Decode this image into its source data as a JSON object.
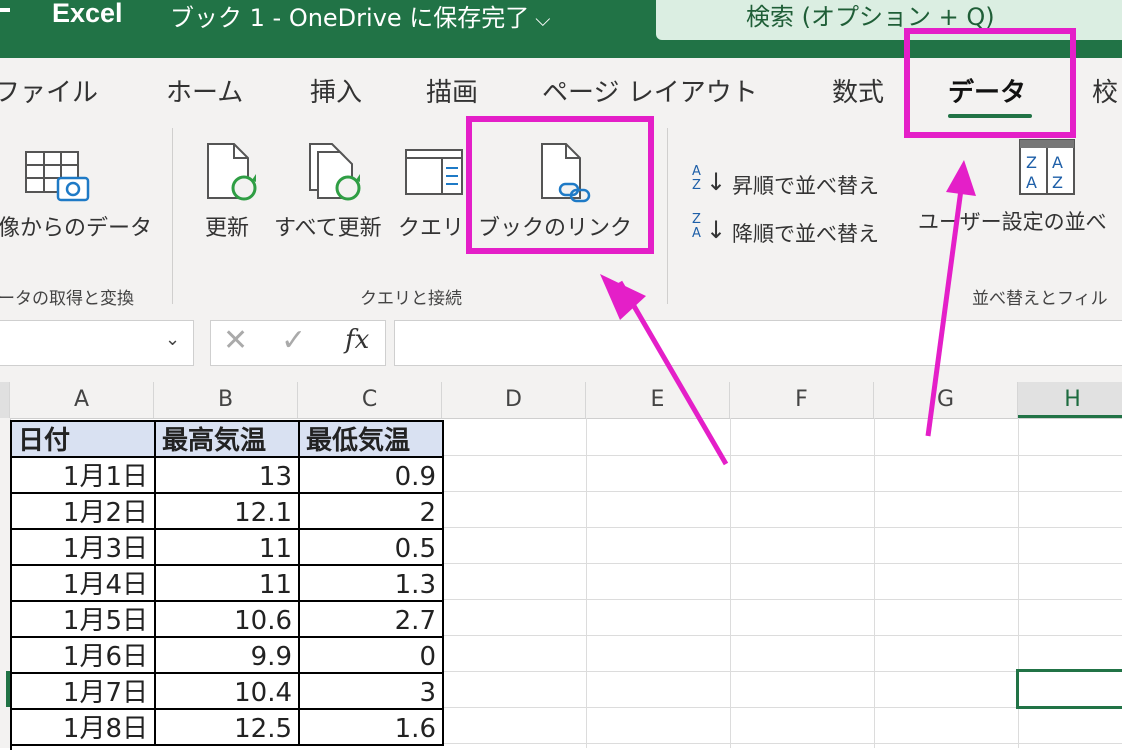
{
  "titlebar": {
    "app_name": "Excel",
    "doc_title": "ブック 1 - OneDrive に保存完了",
    "search": "検索 (オプション + Q)"
  },
  "tabs": [
    "ファイル",
    "ホーム",
    "挿入",
    "描画",
    "ページ レイアウト",
    "数式",
    "データ",
    "校"
  ],
  "ribbon": {
    "get_data_label": "像からのデータ",
    "refresh": "更新",
    "refresh_all": "すべて更新",
    "queries": "クエリ",
    "workbook_links": "ブックのリンク",
    "sort_asc": "昇順で並べ替え",
    "sort_desc": "降順で並べ替え",
    "custom_sort": "ユーザー設定の並べ",
    "sort_icon_asc_top": "A",
    "sort_icon_asc_bottom": "Z",
    "sort_icon_desc_top": "Z",
    "sort_icon_desc_bottom": "A",
    "groups": {
      "get_transform": "ータの取得と変換",
      "queries_connections": "クエリと接続",
      "sort_filter": "並べ替えとフィル"
    }
  },
  "formula_bar": {
    "fx": "fx"
  },
  "columns": [
    "A",
    "B",
    "C",
    "D",
    "E",
    "F",
    "G",
    "H"
  ],
  "table": {
    "headers": [
      "日付",
      "最高気温",
      "最低気温"
    ],
    "rows": [
      [
        "1月1日",
        "13",
        "0.9"
      ],
      [
        "1月2日",
        "12.1",
        "2"
      ],
      [
        "1月3日",
        "11",
        "0.5"
      ],
      [
        "1月4日",
        "11",
        "1.3"
      ],
      [
        "1月5日",
        "10.6",
        "2.7"
      ],
      [
        "1月6日",
        "9.9",
        "0"
      ],
      [
        "1月7日",
        "10.4",
        "3"
      ],
      [
        "1月8日",
        "12.5",
        "1.6"
      ]
    ]
  },
  "colors": {
    "excel_green": "#217346",
    "annotation_magenta": "#e41fc8",
    "header_fill": "#d9e1f2"
  }
}
